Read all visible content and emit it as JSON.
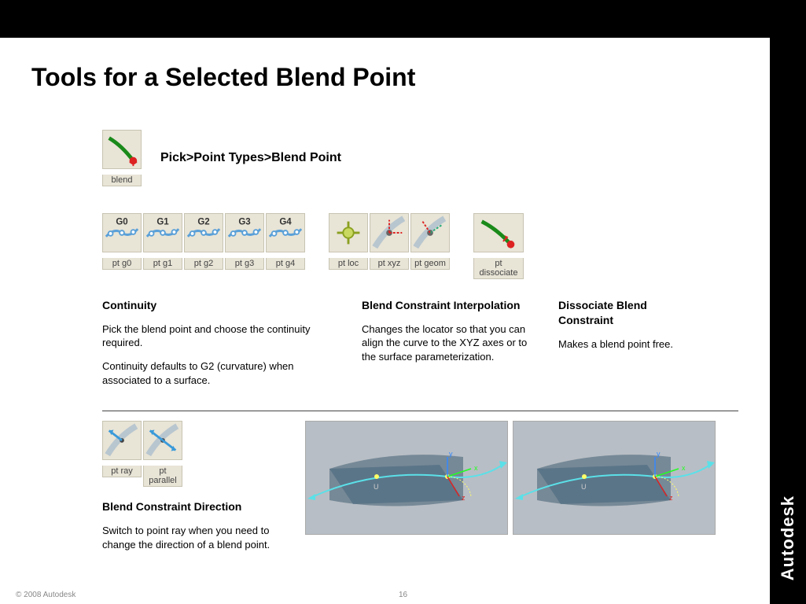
{
  "title": "Tools for a Selected Blend Point",
  "blend_tool": {
    "menu_path": "Pick>Point Types>Blend Point",
    "label": "blend"
  },
  "continuity_icons": [
    "pt g0",
    "pt g1",
    "pt g2",
    "pt g3",
    "pt g4"
  ],
  "interp_icons": [
    "pt loc",
    "pt xyz",
    "pt geom"
  ],
  "dissoc_icon": "pt dissociate",
  "direction_icons": [
    "pt ray",
    "pt parallel"
  ],
  "sections": {
    "continuity": {
      "heading": "Continuity",
      "p1": "Pick the blend point and choose the continuity required.",
      "p2": "Continuity defaults to G2 (curvature) when associated to a surface."
    },
    "interpolation": {
      "heading": "Blend Constraint Interpolation",
      "p1": "Changes the locator so that you can align the curve to the XYZ axes or to the surface parameterization."
    },
    "dissociate": {
      "heading": "Dissociate Blend Constraint",
      "p1": "Makes a blend point free."
    },
    "direction": {
      "heading": "Blend Constraint Direction",
      "p1": "Switch to point ray when you need to change the direction of a blend point."
    }
  },
  "footer": "© 2008 Autodesk",
  "page": "16",
  "brand": "Autodesk"
}
